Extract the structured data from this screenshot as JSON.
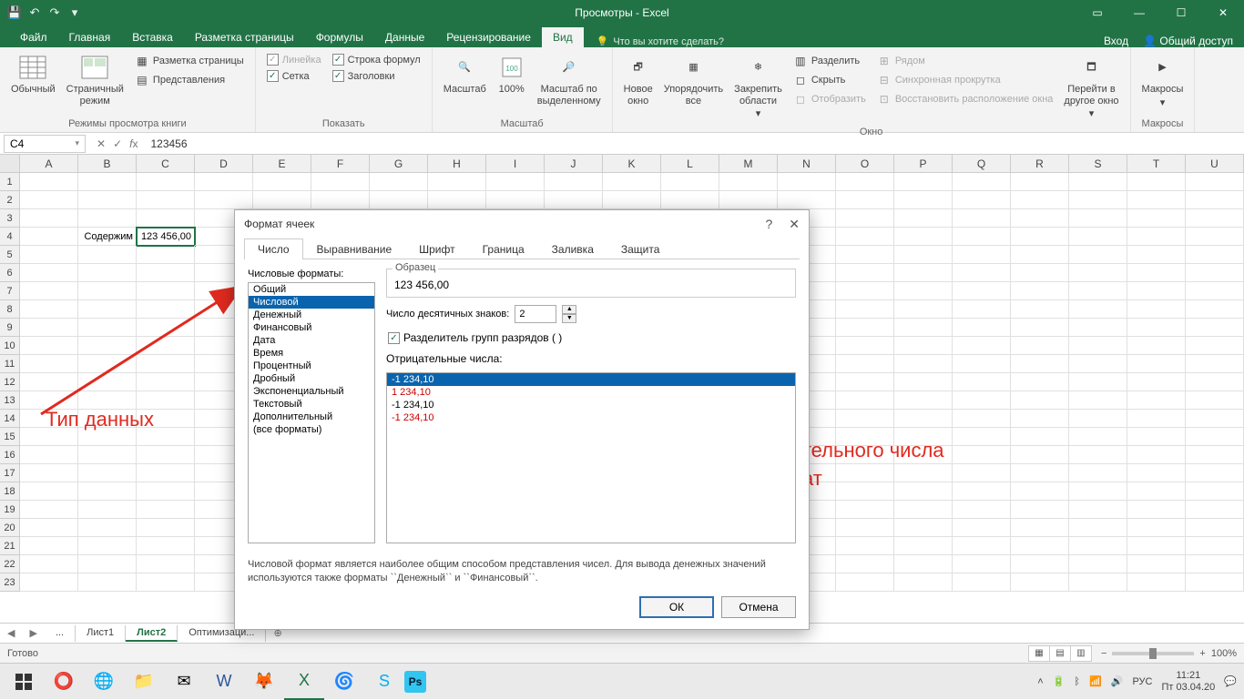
{
  "titlebar": {
    "title": "Просмотры - Excel",
    "login": "Вход",
    "share": "Общий доступ"
  },
  "tabs": [
    "Файл",
    "Главная",
    "Вставка",
    "Разметка страницы",
    "Формулы",
    "Данные",
    "Рецензирование",
    "Вид"
  ],
  "active_tab": "Вид",
  "tellme": "Что вы хотите сделать?",
  "ribbon": {
    "g1": {
      "label": "Режимы просмотра книги",
      "normal": "Обычный",
      "pagebreak": "Страничный\nрежим",
      "pagelayout": "Разметка страницы",
      "custom": "Представления"
    },
    "g2": {
      "label": "Показать",
      "ruler": "Линейка",
      "formulabar": "Строка формул",
      "grid": "Сетка",
      "headings": "Заголовки"
    },
    "g3": {
      "label": "Масштаб",
      "zoom": "Масштаб",
      "z100": "100%",
      "zoomsel": "Масштаб по\nвыделенному"
    },
    "g4": {
      "label": "Окно",
      "newwin": "Новое\nокно",
      "arrange": "Упорядочить\nвсе",
      "freeze": "Закрепить\nобласти",
      "split": "Разделить",
      "hide": "Скрыть",
      "unhide": "Отобразить",
      "side": "Рядом",
      "sync": "Синхронная прокрутка",
      "reset": "Восстановить расположение окна",
      "switch": "Перейти в\nдругое окно"
    },
    "g5": {
      "label": "Макросы",
      "macros": "Макросы"
    }
  },
  "namebox": "C4",
  "formula": "123456",
  "columns": [
    "A",
    "B",
    "C",
    "D",
    "E",
    "F",
    "G",
    "H",
    "I",
    "J",
    "K",
    "L",
    "M",
    "N",
    "O",
    "P",
    "Q",
    "R",
    "S",
    "T",
    "U"
  ],
  "rows_count": 23,
  "cell_b4": "Содержим",
  "cell_c4": "123 456,00",
  "dialog": {
    "title": "Формат ячеек",
    "tabs": [
      "Число",
      "Выравнивание",
      "Шрифт",
      "Граница",
      "Заливка",
      "Защита"
    ],
    "cat_label": "Числовые форматы:",
    "categories": [
      "Общий",
      "Числовой",
      "Денежный",
      "Финансовый",
      "Дата",
      "Время",
      "Процентный",
      "Дробный",
      "Экспоненциальный",
      "Текстовый",
      "Дополнительный",
      "(все форматы)"
    ],
    "selected_category": 1,
    "sample_label": "Образец",
    "sample": "123 456,00",
    "decimals_label": "Число десятичных знаков:",
    "decimals": "2",
    "thousands": "Разделитель групп разрядов ( )",
    "neg_label": "Отрицательные числа:",
    "negatives": [
      "-1 234,10",
      "1 234,10",
      "-1 234,10",
      "-1 234,10"
    ],
    "desc": "Числовой формат является наиболее общим способом представления чисел. Для вывода денежных значений используются также форматы ``Денежный`` и ``Финансовый``.",
    "ok": "ОК",
    "cancel": "Отмена"
  },
  "annot": {
    "left": "Тип данных",
    "right": "Способ вывода отрицательного числа\nили формат"
  },
  "sheets": {
    "tabs": [
      "...",
      "Лист1",
      "Лист2",
      "Оптимизаци..."
    ],
    "active": 2
  },
  "status": {
    "ready": "Готово",
    "zoom": "100%"
  },
  "taskbar": {
    "lang": "РУС",
    "time": "11:21",
    "date": "Пт 03.04.20"
  }
}
